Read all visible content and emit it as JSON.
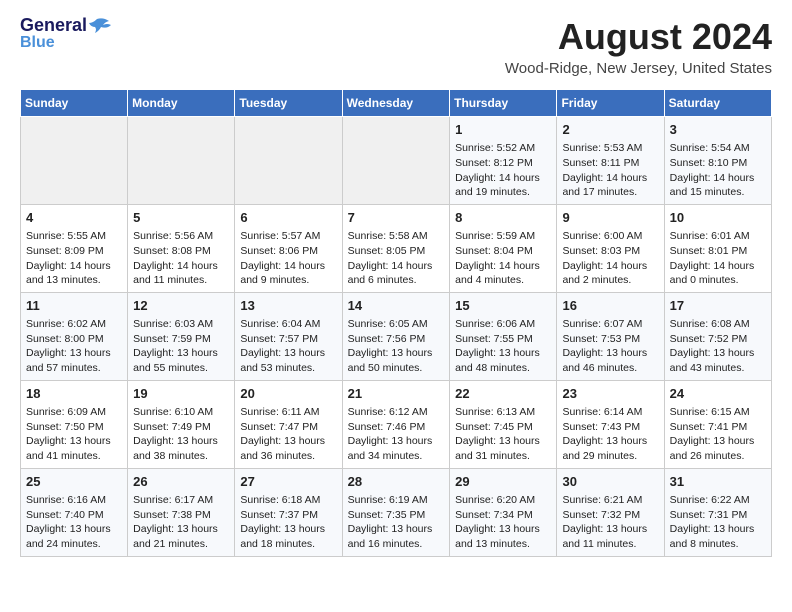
{
  "header": {
    "logo_general": "General",
    "logo_blue": "Blue",
    "title": "August 2024",
    "subtitle": "Wood-Ridge, New Jersey, United States"
  },
  "calendar": {
    "columns": [
      "Sunday",
      "Monday",
      "Tuesday",
      "Wednesday",
      "Thursday",
      "Friday",
      "Saturday"
    ],
    "weeks": [
      [
        {
          "day": "",
          "data": ""
        },
        {
          "day": "",
          "data": ""
        },
        {
          "day": "",
          "data": ""
        },
        {
          "day": "",
          "data": ""
        },
        {
          "day": "1",
          "data": "Sunrise: 5:52 AM\nSunset: 8:12 PM\nDaylight: 14 hours\nand 19 minutes."
        },
        {
          "day": "2",
          "data": "Sunrise: 5:53 AM\nSunset: 8:11 PM\nDaylight: 14 hours\nand 17 minutes."
        },
        {
          "day": "3",
          "data": "Sunrise: 5:54 AM\nSunset: 8:10 PM\nDaylight: 14 hours\nand 15 minutes."
        }
      ],
      [
        {
          "day": "4",
          "data": "Sunrise: 5:55 AM\nSunset: 8:09 PM\nDaylight: 14 hours\nand 13 minutes."
        },
        {
          "day": "5",
          "data": "Sunrise: 5:56 AM\nSunset: 8:08 PM\nDaylight: 14 hours\nand 11 minutes."
        },
        {
          "day": "6",
          "data": "Sunrise: 5:57 AM\nSunset: 8:06 PM\nDaylight: 14 hours\nand 9 minutes."
        },
        {
          "day": "7",
          "data": "Sunrise: 5:58 AM\nSunset: 8:05 PM\nDaylight: 14 hours\nand 6 minutes."
        },
        {
          "day": "8",
          "data": "Sunrise: 5:59 AM\nSunset: 8:04 PM\nDaylight: 14 hours\nand 4 minutes."
        },
        {
          "day": "9",
          "data": "Sunrise: 6:00 AM\nSunset: 8:03 PM\nDaylight: 14 hours\nand 2 minutes."
        },
        {
          "day": "10",
          "data": "Sunrise: 6:01 AM\nSunset: 8:01 PM\nDaylight: 14 hours\nand 0 minutes."
        }
      ],
      [
        {
          "day": "11",
          "data": "Sunrise: 6:02 AM\nSunset: 8:00 PM\nDaylight: 13 hours\nand 57 minutes."
        },
        {
          "day": "12",
          "data": "Sunrise: 6:03 AM\nSunset: 7:59 PM\nDaylight: 13 hours\nand 55 minutes."
        },
        {
          "day": "13",
          "data": "Sunrise: 6:04 AM\nSunset: 7:57 PM\nDaylight: 13 hours\nand 53 minutes."
        },
        {
          "day": "14",
          "data": "Sunrise: 6:05 AM\nSunset: 7:56 PM\nDaylight: 13 hours\nand 50 minutes."
        },
        {
          "day": "15",
          "data": "Sunrise: 6:06 AM\nSunset: 7:55 PM\nDaylight: 13 hours\nand 48 minutes."
        },
        {
          "day": "16",
          "data": "Sunrise: 6:07 AM\nSunset: 7:53 PM\nDaylight: 13 hours\nand 46 minutes."
        },
        {
          "day": "17",
          "data": "Sunrise: 6:08 AM\nSunset: 7:52 PM\nDaylight: 13 hours\nand 43 minutes."
        }
      ],
      [
        {
          "day": "18",
          "data": "Sunrise: 6:09 AM\nSunset: 7:50 PM\nDaylight: 13 hours\nand 41 minutes."
        },
        {
          "day": "19",
          "data": "Sunrise: 6:10 AM\nSunset: 7:49 PM\nDaylight: 13 hours\nand 38 minutes."
        },
        {
          "day": "20",
          "data": "Sunrise: 6:11 AM\nSunset: 7:47 PM\nDaylight: 13 hours\nand 36 minutes."
        },
        {
          "day": "21",
          "data": "Sunrise: 6:12 AM\nSunset: 7:46 PM\nDaylight: 13 hours\nand 34 minutes."
        },
        {
          "day": "22",
          "data": "Sunrise: 6:13 AM\nSunset: 7:45 PM\nDaylight: 13 hours\nand 31 minutes."
        },
        {
          "day": "23",
          "data": "Sunrise: 6:14 AM\nSunset: 7:43 PM\nDaylight: 13 hours\nand 29 minutes."
        },
        {
          "day": "24",
          "data": "Sunrise: 6:15 AM\nSunset: 7:41 PM\nDaylight: 13 hours\nand 26 minutes."
        }
      ],
      [
        {
          "day": "25",
          "data": "Sunrise: 6:16 AM\nSunset: 7:40 PM\nDaylight: 13 hours\nand 24 minutes."
        },
        {
          "day": "26",
          "data": "Sunrise: 6:17 AM\nSunset: 7:38 PM\nDaylight: 13 hours\nand 21 minutes."
        },
        {
          "day": "27",
          "data": "Sunrise: 6:18 AM\nSunset: 7:37 PM\nDaylight: 13 hours\nand 18 minutes."
        },
        {
          "day": "28",
          "data": "Sunrise: 6:19 AM\nSunset: 7:35 PM\nDaylight: 13 hours\nand 16 minutes."
        },
        {
          "day": "29",
          "data": "Sunrise: 6:20 AM\nSunset: 7:34 PM\nDaylight: 13 hours\nand 13 minutes."
        },
        {
          "day": "30",
          "data": "Sunrise: 6:21 AM\nSunset: 7:32 PM\nDaylight: 13 hours\nand 11 minutes."
        },
        {
          "day": "31",
          "data": "Sunrise: 6:22 AM\nSunset: 7:31 PM\nDaylight: 13 hours\nand 8 minutes."
        }
      ]
    ]
  }
}
